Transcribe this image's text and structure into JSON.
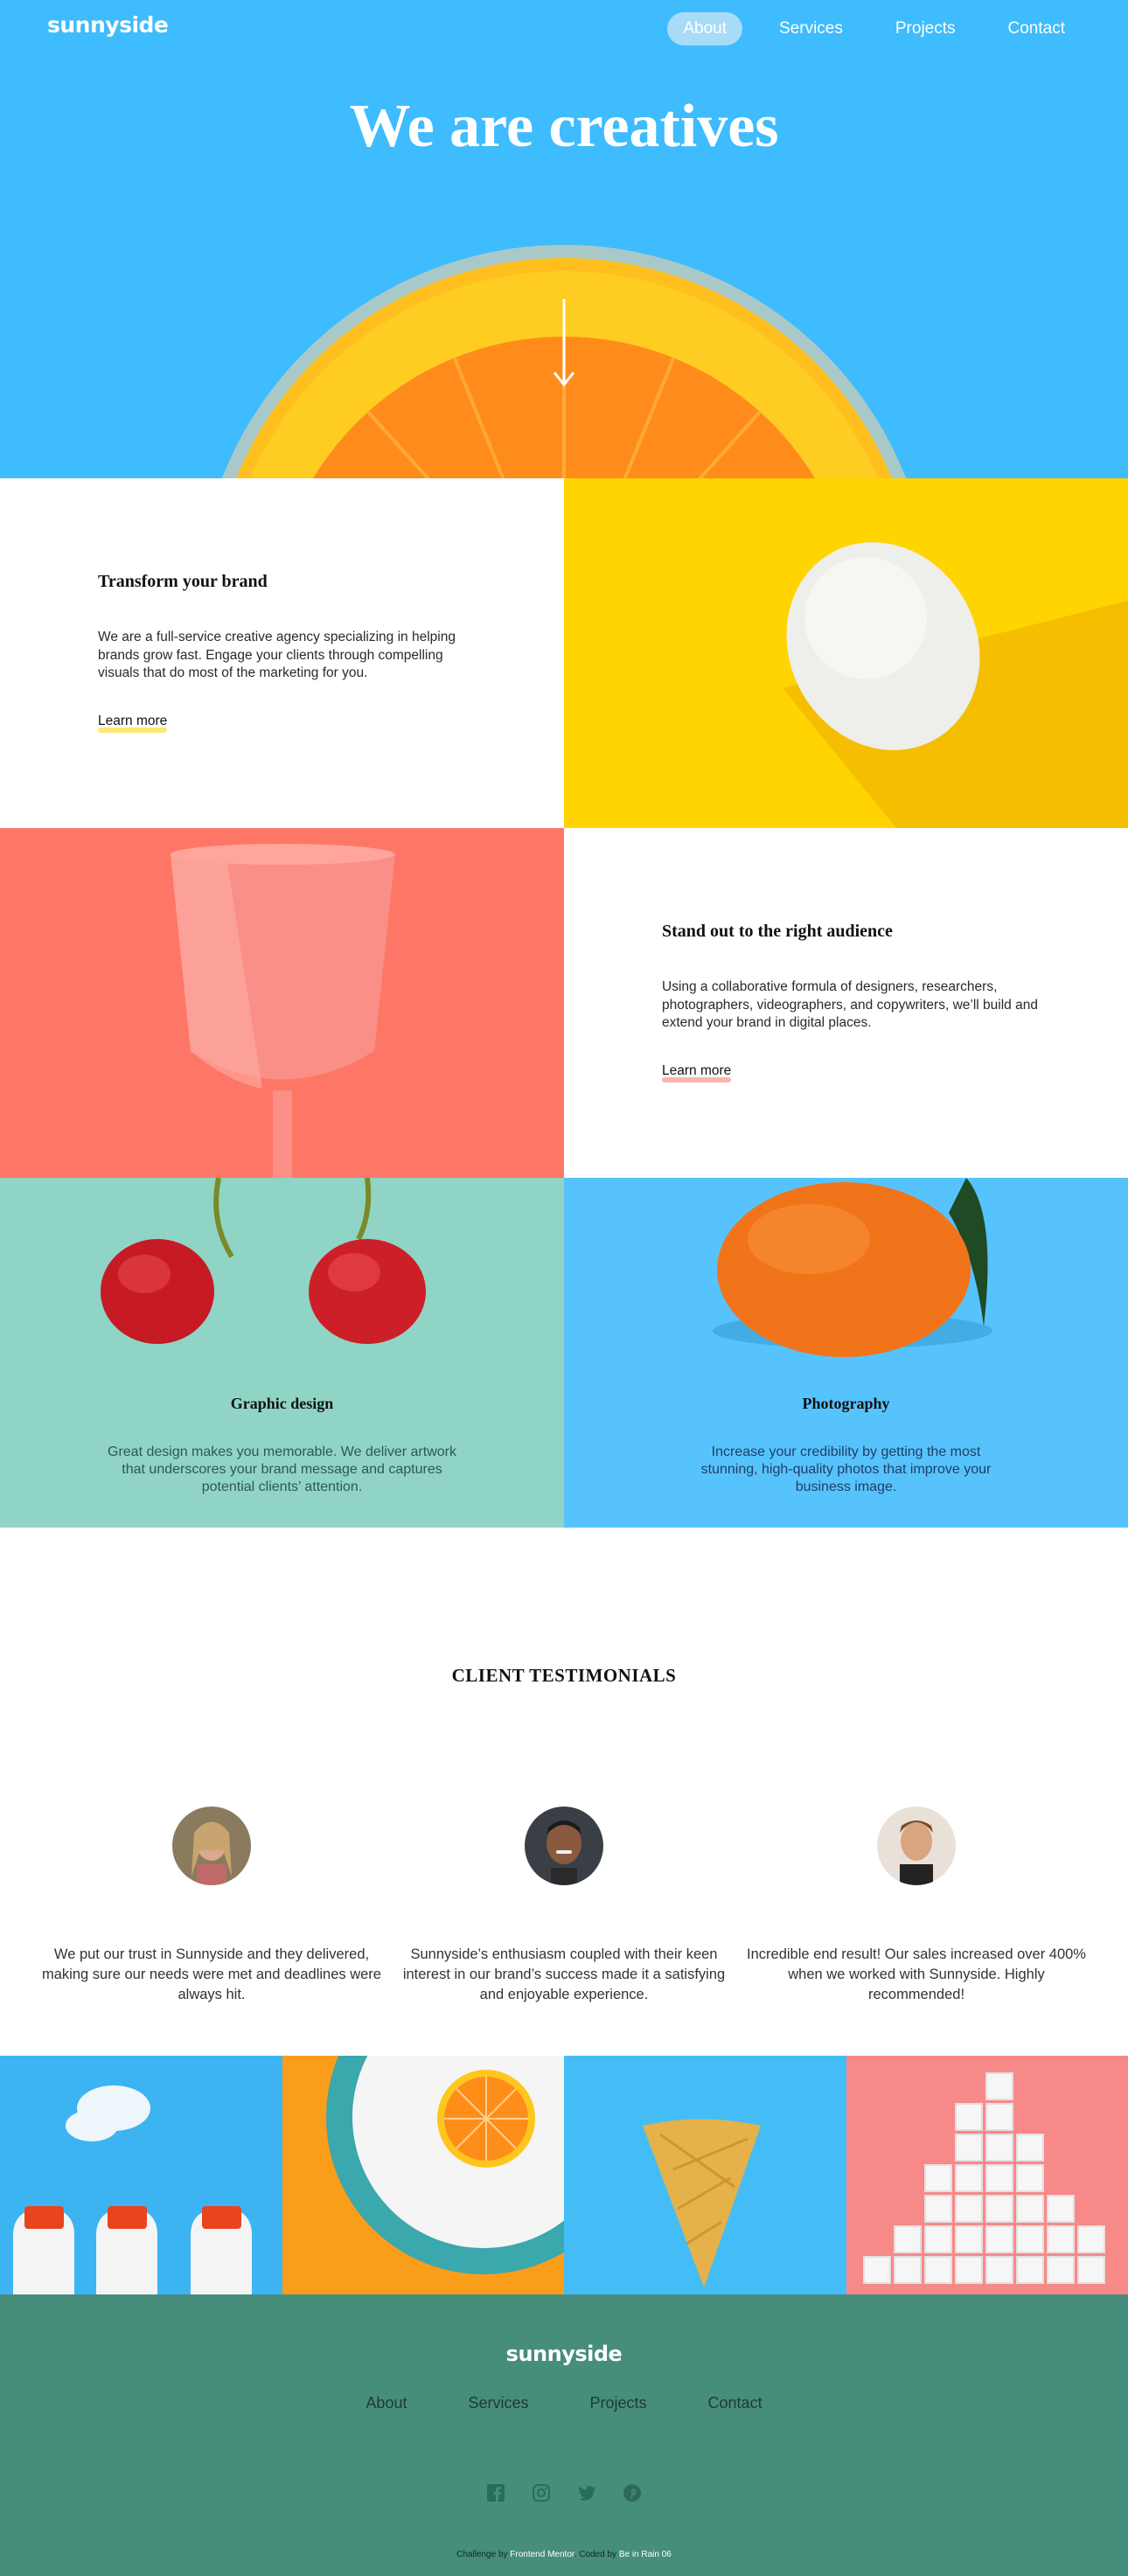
{
  "brand": "sunnyside",
  "nav": [
    {
      "label": "About",
      "active": true
    },
    {
      "label": "Services",
      "active": false
    },
    {
      "label": "Projects",
      "active": false
    },
    {
      "label": "Contact",
      "active": false
    }
  ],
  "hero": {
    "title": "We are creatives",
    "arrow_icon": "arrow-down-icon"
  },
  "features": [
    {
      "title": "Transform your brand",
      "body": "We are a full-service creative agency specializing in helping brands grow fast. Engage your clients through compelling visuals that do most of the marketing for you.",
      "link": "Learn more",
      "underline_color": "#fad400",
      "image": "egg-image",
      "image_bg": "#ffd400"
    },
    {
      "title": "Stand out to the right audience",
      "body": "Using a collaborative formula of designers, researchers, photographers, videographers, and copywriters, we’ll build and extend your brand in digital places.",
      "link": "Learn more",
      "underline_color": "#fe7766",
      "image": "cup-image",
      "image_bg": "#fe7766"
    }
  ],
  "services": [
    {
      "title": "Graphic design",
      "body": "Great design makes you memorable. We deliver artwork that underscores your brand message and captures potential clients’ attention.",
      "text_color": "#2c5a4f",
      "bg": "#90d4c5",
      "image": "cherries-image"
    },
    {
      "title": "Photography",
      "body": "Increase your credibility by getting the most stunning, high-quality photos that improve your business image.",
      "text_color": "#1e3e66",
      "bg": "#57c3fc",
      "image": "orange-image"
    }
  ],
  "testimonials": {
    "heading": "CLIENT TESTIMONIALS",
    "items": [
      {
        "avatar": "emily-avatar",
        "quote": "We put our trust in Sunnyside and they delivered, making sure our needs were met and deadlines were always hit."
      },
      {
        "avatar": "thomas-avatar",
        "quote": "Sunnyside’s enthusiasm coupled with their keen interest in our brand’s success made it a satisfying and enjoyable experience."
      },
      {
        "avatar": "jennie-avatar",
        "quote": "Incredible end result! Our sales increased over 400% when we worked with Sunnyside. Highly recommended!"
      }
    ]
  },
  "gallery": [
    "milk-bottles-image",
    "orange-plate-image",
    "ice-cream-cone-image",
    "sugar-cubes-image"
  ],
  "footer": {
    "brand": "sunnyside",
    "nav": [
      "About",
      "Services",
      "Projects",
      "Contact"
    ],
    "socials": [
      "facebook-icon",
      "instagram-icon",
      "twitter-icon",
      "pinterest-icon"
    ],
    "attribution": {
      "challenge_prefix": "Challenge by",
      "challenge_by": "Frontend Mentor",
      "coded_prefix": ". Coded by",
      "coded_by": "Be in Rain 06"
    }
  },
  "colors": {
    "hero_bg": "#3ebcfd",
    "footer_bg": "#468d7c",
    "yellow": "#ffd400",
    "coral": "#fe7766",
    "mint": "#90d4c5",
    "sky": "#57c3fc"
  }
}
